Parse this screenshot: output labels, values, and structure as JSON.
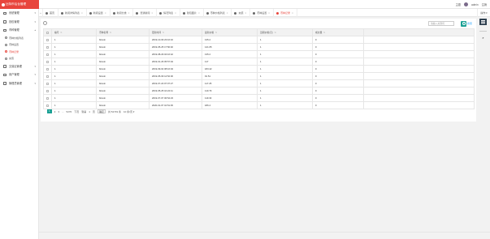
{
  "brand": {
    "title": "比特币后台管理"
  },
  "topbar": {
    "theme_label": "主题",
    "username": "admin",
    "logout_label": "注销"
  },
  "sidebar": {
    "items": [
      {
        "label": "系统管理",
        "icon": "settings-icon"
      },
      {
        "label": "钱包管理",
        "icon": "wallet-icon"
      },
      {
        "label": "币种管理",
        "icon": "coin-icon"
      }
    ],
    "sub_items": [
      {
        "label": "币种价格列表"
      },
      {
        "label": "币种设置"
      },
      {
        "label": "币种记录",
        "active": true
      },
      {
        "label": "充值"
      }
    ],
    "items_bottom": [
      {
        "label": "交易区管理",
        "icon": "exchange-icon"
      },
      {
        "label": "用户管理",
        "icon": "user-icon"
      },
      {
        "label": "管理员管理",
        "icon": "admin-icon"
      }
    ]
  },
  "tabs": [
    {
      "label": "首页"
    },
    {
      "label": "新闻详情列表"
    },
    {
      "label": "新闻设置"
    },
    {
      "label": "新闻分类"
    },
    {
      "label": "普通新闻"
    },
    {
      "label": "情况列表"
    },
    {
      "label": "钱包图片"
    },
    {
      "label": "币种价格列表"
    },
    {
      "label": "充值"
    },
    {
      "label": "币种设置"
    },
    {
      "label": "币种记录",
      "active": true
    }
  ],
  "tab_ops_label": "操作",
  "toolbar": {
    "search_placeholder": "请输入关键词",
    "more_label": "搜索"
  },
  "table": {
    "headers": [
      "编号",
      "币种名称",
      "更新时间",
      "最新价格",
      "近期价格(元)",
      "成交量"
    ],
    "rows": [
      [
        "1",
        "bitcoin",
        "2019-10-09 23:16:16",
        "135.2",
        "1",
        "0"
      ],
      [
        "1",
        "bitcoin",
        "2019-05-25 17:50:40",
        "141.65",
        "1",
        "0"
      ],
      [
        "1",
        "bitcoin",
        "2019-08-29 04:16:42",
        "135.2",
        "1",
        "0"
      ],
      [
        "1",
        "bitcoin",
        "2019-01-26 05:57:04",
        "117",
        "1",
        "0"
      ],
      [
        "1",
        "bitcoin",
        "2019-09-02 08:16:04",
        "183.42",
        "1",
        "0"
      ],
      [
        "1",
        "bitcoin",
        "2019-05-09 14:52:30",
        "91.51",
        "1",
        "0"
      ],
      [
        "1",
        "bitcoin",
        "2019-07-20 07:07:27",
        "117.25",
        "1",
        "0"
      ],
      [
        "1",
        "bitcoin",
        "2019-05-25 10:24:11",
        "110.79",
        "1",
        "0"
      ],
      [
        "1",
        "bitcoin",
        "2019-07-07 06:54:23",
        "119.33",
        "1",
        "0"
      ],
      [
        "1",
        "bitcoin",
        "2020-01-07 10:51:45",
        "186.4",
        "1",
        "0"
      ]
    ]
  },
  "pager": {
    "current": "1",
    "next_pages": [
      "2",
      "3"
    ],
    "ellipsis": "...",
    "last": "5276",
    "next_label": "下页",
    "goto_prefix": "到第",
    "goto_input": "1",
    "goto_suffix": "页",
    "go_label": "确定",
    "total_label": "共 52749 条",
    "per_page": "10 条/页"
  }
}
